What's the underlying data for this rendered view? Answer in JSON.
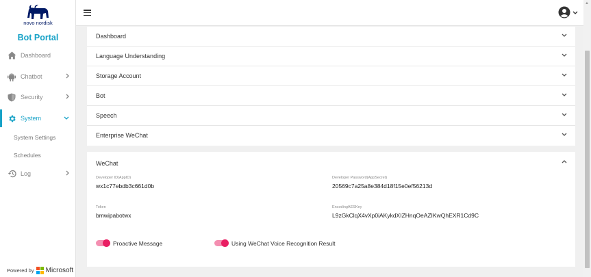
{
  "brand": {
    "logo_text": "novo nordisk",
    "portal_title": "Bot Portal"
  },
  "sidebar": {
    "items": [
      {
        "label": "Dashboard",
        "icon": "home-icon"
      },
      {
        "label": "Chatbot",
        "icon": "android-icon"
      },
      {
        "label": "Security",
        "icon": "shield-icon"
      },
      {
        "label": "System",
        "icon": "gear-icon"
      },
      {
        "label": "Log",
        "icon": "history-icon"
      }
    ],
    "system_sub_items": [
      "System Settings",
      "Schedules"
    ],
    "powered_by": "Powered by",
    "microsoft": "Microsoft"
  },
  "header": {
    "menu_icon": "hamburger-icon",
    "user_icon": "account-circle-icon"
  },
  "panels": [
    {
      "title": "Dashboard"
    },
    {
      "title": "Language Understanding"
    },
    {
      "title": "Storage Account"
    },
    {
      "title": "Bot"
    },
    {
      "title": "Speech"
    },
    {
      "title": "Enterprise WeChat"
    }
  ],
  "wechat": {
    "title": "WeChat",
    "app_id_label": "Developer ID(AppID)",
    "app_id_value": "wx1c77ebdb3c661d0b",
    "app_secret_label": "Developer Password(AppSecret)",
    "app_secret_value": "20569c7a25a8e384d18f15e0ef56213d",
    "token_label": "Token",
    "token_value": "bmwipabotwx",
    "aes_key_label": "EncodingAESKey",
    "aes_key_value": "L9zGkClqX4vXp0iAKykdXIZHnqOeAZIKwQhEXR1Cd9C",
    "proactive_label": "Proactive Message",
    "proactive_on": true,
    "voice_label": "Using WeChat Voice Recognition Result",
    "voice_on": true
  },
  "colors": {
    "accent": "#17a2c7",
    "toggle": "#e91e63",
    "toggle_track": "#f48fb1"
  }
}
